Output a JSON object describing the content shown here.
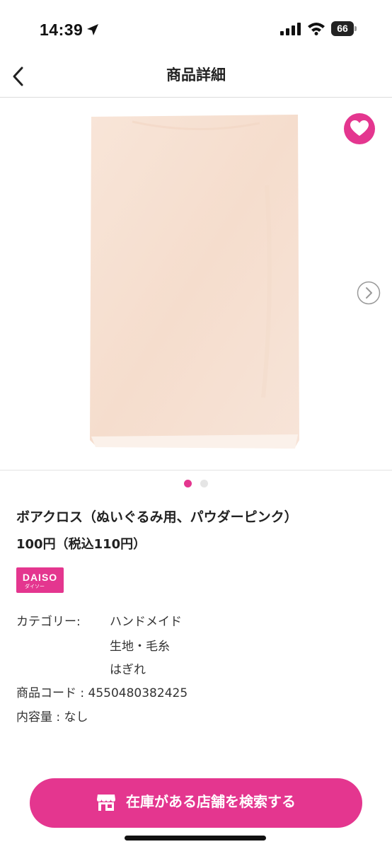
{
  "status_bar": {
    "time": "14:39",
    "battery": "66",
    "icons": [
      "location-arrow-icon",
      "cellular-signal-icon",
      "wifi-icon",
      "battery-icon"
    ]
  },
  "nav": {
    "title": "商品詳細",
    "back_icon": "chevron-left-icon"
  },
  "gallery": {
    "image_alt": "powder pink boa cloth",
    "favorite_icon": "heart-icon",
    "next_icon": "chevron-right-circle-icon",
    "current_index": 1,
    "total": 2
  },
  "product": {
    "name": "ボアクロス（ぬいぐるみ用、パウダーピンク）",
    "price": "100円（税込110円）",
    "brand": {
      "name": "DAISO",
      "sub": "ダイソー"
    },
    "category_label": "カテゴリー:",
    "categories": [
      "ハンドメイド",
      "生地・毛糸",
      "はぎれ"
    ],
    "code": "商品コード : 4550480382425",
    "volume": "内容量 : なし"
  },
  "cta": {
    "label": "在庫がある店舗を検索する",
    "icon": "store-icon"
  },
  "colors": {
    "accent": "#e4368f",
    "fabric": "#f7e3d6"
  }
}
